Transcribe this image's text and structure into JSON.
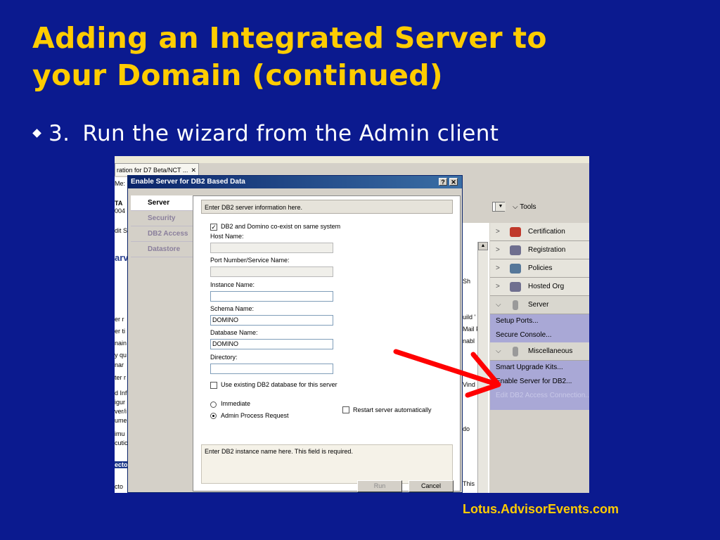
{
  "slide": {
    "title_line1": "Adding an Integrated Server to",
    "title_line2": "your Domain (continued)",
    "bullet_number": "3.",
    "bullet_text": "Run the wizard from the Admin client",
    "footer": "Lotus.AdvisorEvents.com"
  },
  "admin": {
    "doc_tab": "ration for D7 Beta/NCT ...",
    "doc_tab_close": "✕",
    "tools_label": "Tools",
    "left_fragments": [
      "Me:",
      "TA",
      "004",
      "dit S",
      "arv",
      "er r",
      "er ti",
      "nain",
      "y qu",
      "nar",
      "ter r",
      "d Inf",
      "igur",
      "ver/i",
      "ume",
      "imu",
      "cutic",
      "ecto",
      "cto"
    ],
    "mid_fragments": [
      "Sh",
      "uild '",
      "Mail F",
      "nabl",
      "Vind",
      "do",
      "This"
    ],
    "nav_items": [
      {
        "label": "Certification",
        "icon": "certificate-icon",
        "color": "#c0392b"
      },
      {
        "label": "Registration",
        "icon": "registration-icon",
        "color": "#6f6f8f"
      },
      {
        "label": "Policies",
        "icon": "policies-icon",
        "color": "#557799"
      },
      {
        "label": "Hosted Org",
        "icon": "hosted-org-icon",
        "color": "#6f6f8f"
      },
      {
        "label": "Server",
        "icon": "server-icon",
        "color": "#9a9a9a"
      }
    ],
    "server_subitems": [
      "Setup Ports...",
      "Secure Console..."
    ],
    "misc_label": "Miscellaneous",
    "misc_subitems": [
      "Smart Upgrade Kits...",
      "Enable Server for DB2..."
    ],
    "misc_disabled_item": "Edit DB2 Access Connection..."
  },
  "dialog": {
    "title": "Enable Server for DB2 Based Data",
    "help_btn": "?",
    "close_btn": "✕",
    "tabs": [
      "Server",
      "Security",
      "DB2 Access",
      "Datastore"
    ],
    "active_tab": "Server",
    "header_text": "Enter DB2 server information here.",
    "coexist_label": "DB2 and Domino co-exist on same system",
    "coexist_checked": "✓",
    "host_label": "Host Name:",
    "host_value": "",
    "port_label": "Port Number/Service Name:",
    "port_value": "",
    "instance_label": "Instance Name:",
    "instance_value": "",
    "schema_label": "Schema Name:",
    "schema_value": "DOMINO",
    "database_label": "Database Name:",
    "database_value": "DOMINO",
    "directory_label": "Directory:",
    "directory_value": "",
    "use_existing_label": "Use existing DB2 database for this server",
    "immediate_label": "Immediate",
    "admin_process_label": "Admin Process Request",
    "restart_label": "Restart server automatically",
    "help_text": "Enter DB2 instance name here. This field is required.",
    "run_label": "Run",
    "cancel_label": "Cancel"
  },
  "colors": {
    "slide_bg": "#0b1a8f",
    "title": "#ffcc00",
    "arrow": "#ff0000",
    "nav_highlight": "#a9a8d6"
  }
}
